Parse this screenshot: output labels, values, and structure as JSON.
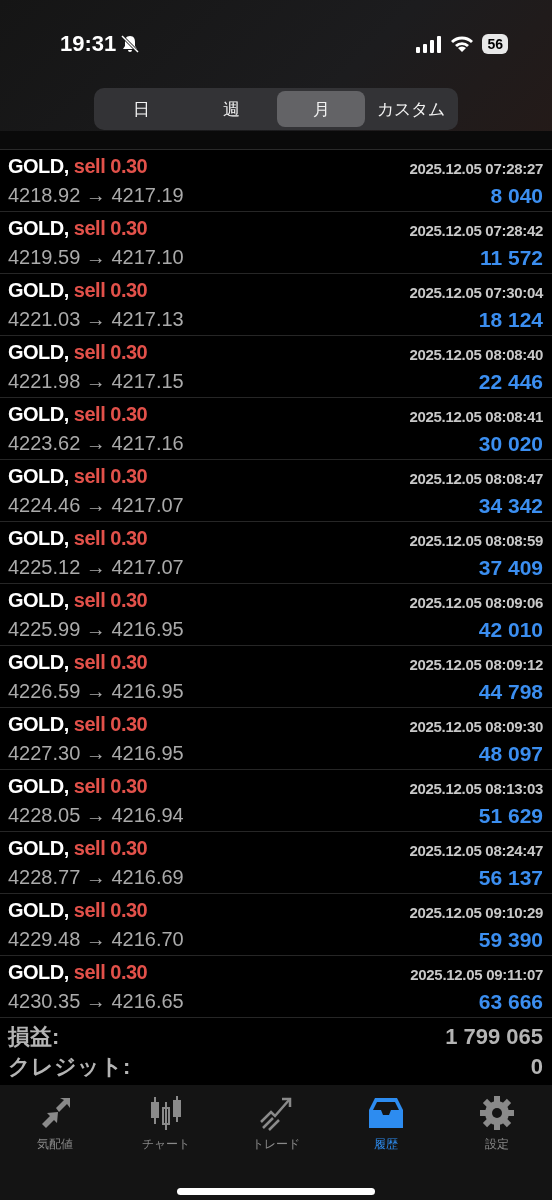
{
  "status_bar": {
    "time": "19:31",
    "battery": "56"
  },
  "period_tabs": [
    {
      "label": "日",
      "selected": false
    },
    {
      "label": "週",
      "selected": false
    },
    {
      "label": "月",
      "selected": true
    },
    {
      "label": "カスタム",
      "selected": false
    }
  ],
  "trades": [
    {
      "symbol": "GOLD,",
      "side": "sell 0.30",
      "time": "2025.12.05 07:28:27",
      "prices": "4218.92 → 4217.19",
      "profit": "8 040"
    },
    {
      "symbol": "GOLD,",
      "side": "sell 0.30",
      "time": "2025.12.05 07:28:42",
      "prices": "4219.59 → 4217.10",
      "profit": "11 572"
    },
    {
      "symbol": "GOLD,",
      "side": "sell 0.30",
      "time": "2025.12.05 07:30:04",
      "prices": "4221.03 → 4217.13",
      "profit": "18 124"
    },
    {
      "symbol": "GOLD,",
      "side": "sell 0.30",
      "time": "2025.12.05 08:08:40",
      "prices": "4221.98 → 4217.15",
      "profit": "22 446"
    },
    {
      "symbol": "GOLD,",
      "side": "sell 0.30",
      "time": "2025.12.05 08:08:41",
      "prices": "4223.62 → 4217.16",
      "profit": "30 020"
    },
    {
      "symbol": "GOLD,",
      "side": "sell 0.30",
      "time": "2025.12.05 08:08:47",
      "prices": "4224.46 → 4217.07",
      "profit": "34 342"
    },
    {
      "symbol": "GOLD,",
      "side": "sell 0.30",
      "time": "2025.12.05 08:08:59",
      "prices": "4225.12 → 4217.07",
      "profit": "37 409"
    },
    {
      "symbol": "GOLD,",
      "side": "sell 0.30",
      "time": "2025.12.05 08:09:06",
      "prices": "4225.99 → 4216.95",
      "profit": "42 010"
    },
    {
      "symbol": "GOLD,",
      "side": "sell 0.30",
      "time": "2025.12.05 08:09:12",
      "prices": "4226.59 → 4216.95",
      "profit": "44 798"
    },
    {
      "symbol": "GOLD,",
      "side": "sell 0.30",
      "time": "2025.12.05 08:09:30",
      "prices": "4227.30 → 4216.95",
      "profit": "48 097"
    },
    {
      "symbol": "GOLD,",
      "side": "sell 0.30",
      "time": "2025.12.05 08:13:03",
      "prices": "4228.05 → 4216.94",
      "profit": "51 629"
    },
    {
      "symbol": "GOLD,",
      "side": "sell 0.30",
      "time": "2025.12.05 08:24:47",
      "prices": "4228.77 → 4216.69",
      "profit": "56 137"
    },
    {
      "symbol": "GOLD,",
      "side": "sell 0.30",
      "time": "2025.12.05 09:10:29",
      "prices": "4229.48 → 4216.70",
      "profit": "59 390"
    },
    {
      "symbol": "GOLD,",
      "side": "sell 0.30",
      "time": "2025.12.05 09:11:07",
      "prices": "4230.35 → 4216.65",
      "profit": "63 666"
    }
  ],
  "totals": [
    {
      "label": "損益:",
      "value": "1 799 065"
    },
    {
      "label": "クレジット:",
      "value": "0"
    }
  ],
  "nav_tabs": [
    {
      "kind": "quotes",
      "label": "気配値",
      "selected": false
    },
    {
      "kind": "chart",
      "label": "チャート",
      "selected": false
    },
    {
      "kind": "trade",
      "label": "トレード",
      "selected": false
    },
    {
      "kind": "history",
      "label": "履歴",
      "selected": true
    },
    {
      "kind": "settings",
      "label": "設定",
      "selected": false
    }
  ]
}
